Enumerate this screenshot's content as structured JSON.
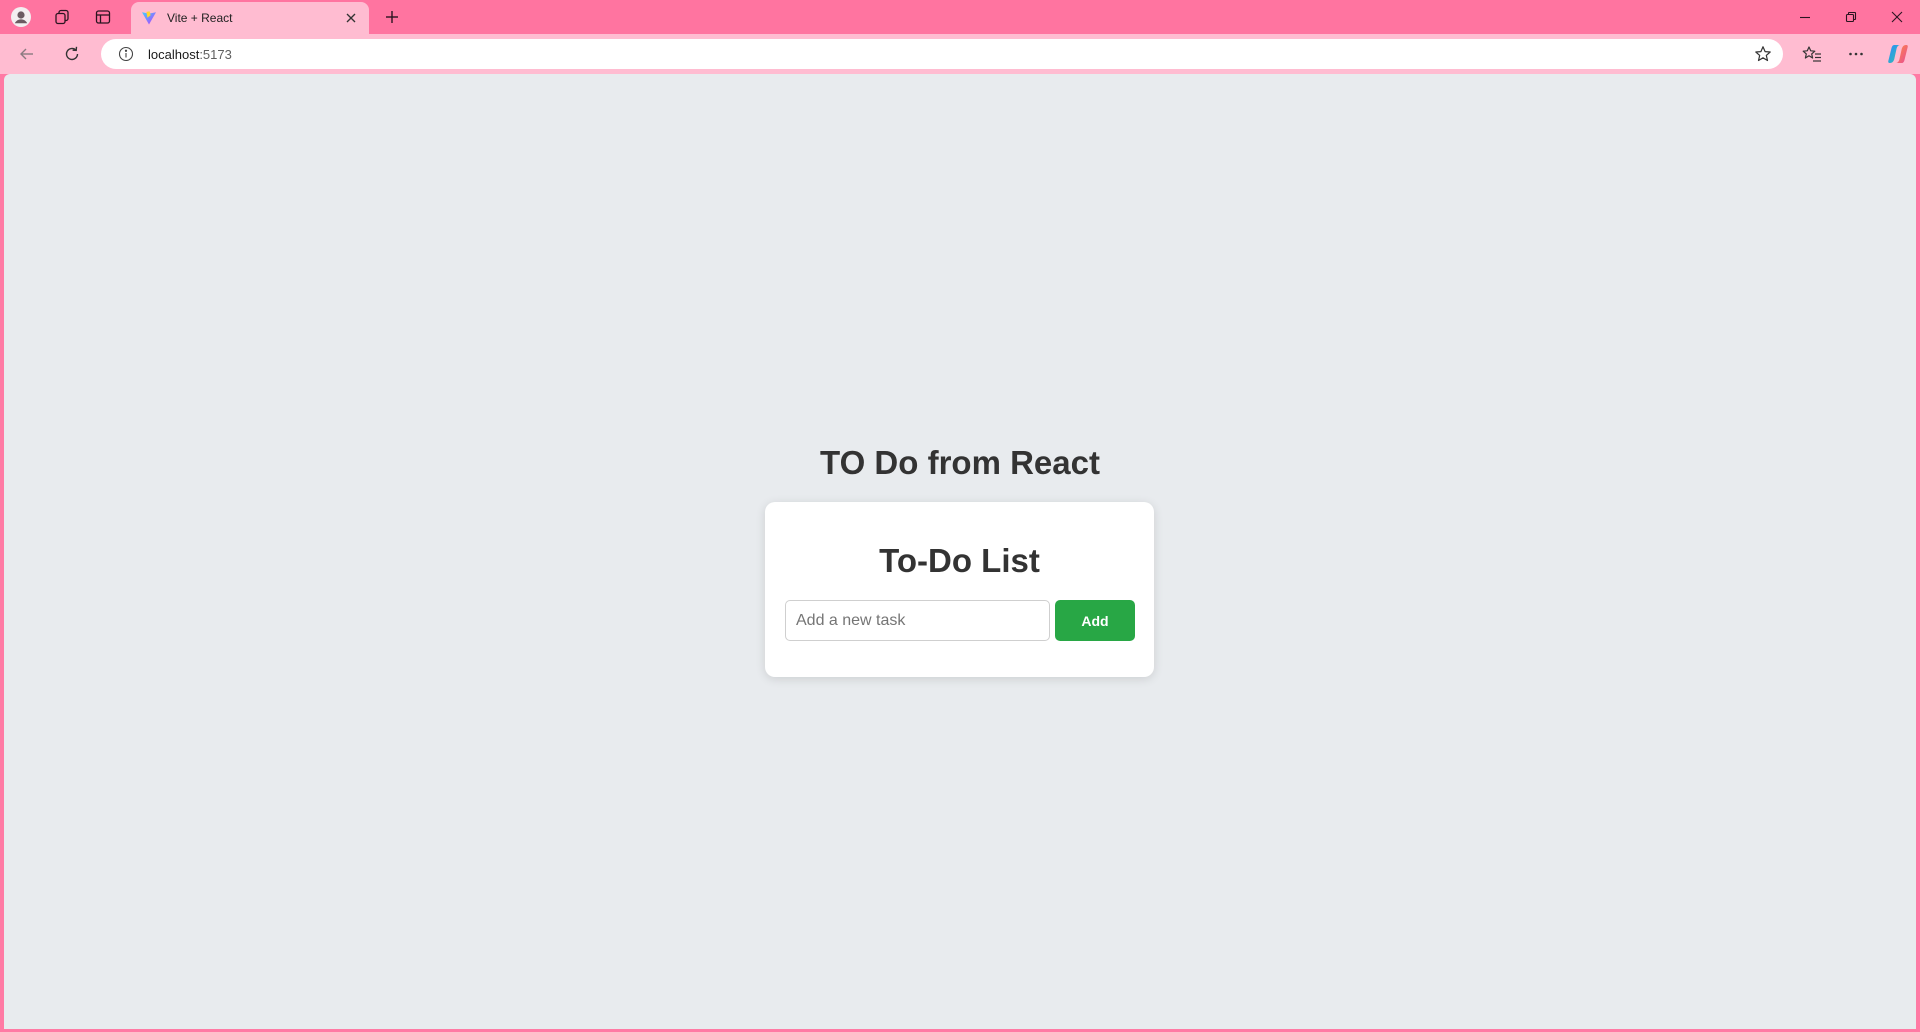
{
  "browser": {
    "tab": {
      "title": "Vite + React"
    },
    "address_bar": {
      "host": "localhost",
      "port": ":5173"
    },
    "icons": {
      "profile": "profile-icon",
      "workspaces": "workspaces-icon",
      "tab_actions": "tab-actions-icon",
      "favicon": "vite-favicon-icon",
      "close_tab": "close-icon",
      "new_tab": "plus-icon",
      "minimize": "minimize-icon",
      "restore": "restore-icon",
      "close_window": "close-icon",
      "back": "back-arrow-icon",
      "refresh": "refresh-icon",
      "site_info": "info-icon",
      "favorite": "star-icon",
      "favorites": "favorites-icon",
      "more": "more-icon",
      "copilot": "copilot-icon"
    },
    "colors": {
      "titlebar": "#ff74a0",
      "toolbar": "#ffbcd1",
      "page_background": "#e8ebee"
    }
  },
  "page": {
    "heading": "TO Do from React",
    "card": {
      "title": "To-Do List",
      "input": {
        "placeholder": "Add a new task",
        "value": ""
      },
      "add_button_label": "Add"
    },
    "colors": {
      "add_button": "#28a745",
      "text": "#333333"
    }
  }
}
